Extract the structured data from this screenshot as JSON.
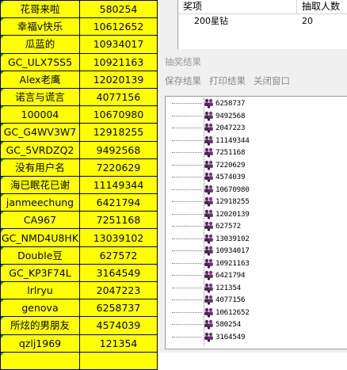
{
  "sheet": {
    "rows": [
      {
        "name": "花哥来啦",
        "id": "580254"
      },
      {
        "name": "幸福v快乐",
        "id": "10612652"
      },
      {
        "name": "瓜蓝的",
        "id": "10934017"
      },
      {
        "name": "GC_ULX7SS5",
        "id": "10921163"
      },
      {
        "name": "Alex老鹰",
        "id": "12020139"
      },
      {
        "name": "诺言与谎言",
        "id": "4077156"
      },
      {
        "name": "100004",
        "id": "10670980"
      },
      {
        "name": "GC_G4WV3W7",
        "id": "12918255"
      },
      {
        "name": "GC_5VRDZQ2",
        "id": "9492568"
      },
      {
        "name": "没有用户名",
        "id": "7220629"
      },
      {
        "name": "海已眠花已谢",
        "id": "11149344"
      },
      {
        "name": "janmeechung",
        "id": "6421794"
      },
      {
        "name": "CA967",
        "id": "7251168"
      },
      {
        "name": "GC_NMD4U8HK",
        "id": "13039102"
      },
      {
        "name": "Double豆",
        "id": "627572"
      },
      {
        "name": "GC_KP3F74L",
        "id": "3164549"
      },
      {
        "name": "lrlryu",
        "id": "2047223"
      },
      {
        "name": "genova",
        "id": "6258737"
      },
      {
        "name": "所炫的男朋友",
        "id": "4574039"
      },
      {
        "name": "qzlj1969",
        "id": "121354"
      },
      {
        "name": "",
        "id": ""
      }
    ]
  },
  "prize_list": {
    "headers": {
      "prize": "奖项",
      "count": "抽取人数"
    },
    "rows": [
      {
        "prize": "200星钻",
        "count": "20"
      }
    ]
  },
  "group_label": "抽奖结果",
  "toolbar": {
    "save": "保存结果",
    "print": "打印结果",
    "close": "关闭窗口"
  },
  "result_tree": {
    "items": [
      "6258737",
      "9492568",
      "2047223",
      "11149344",
      "7251168",
      "7220629",
      "4574039",
      "10670980",
      "12918255",
      "12020139",
      "627572",
      "13039102",
      "10934017",
      "10921163",
      "6421794",
      "121354",
      "4077156",
      "10612652",
      "580254",
      "3164549"
    ],
    "icon": "people-icon"
  }
}
